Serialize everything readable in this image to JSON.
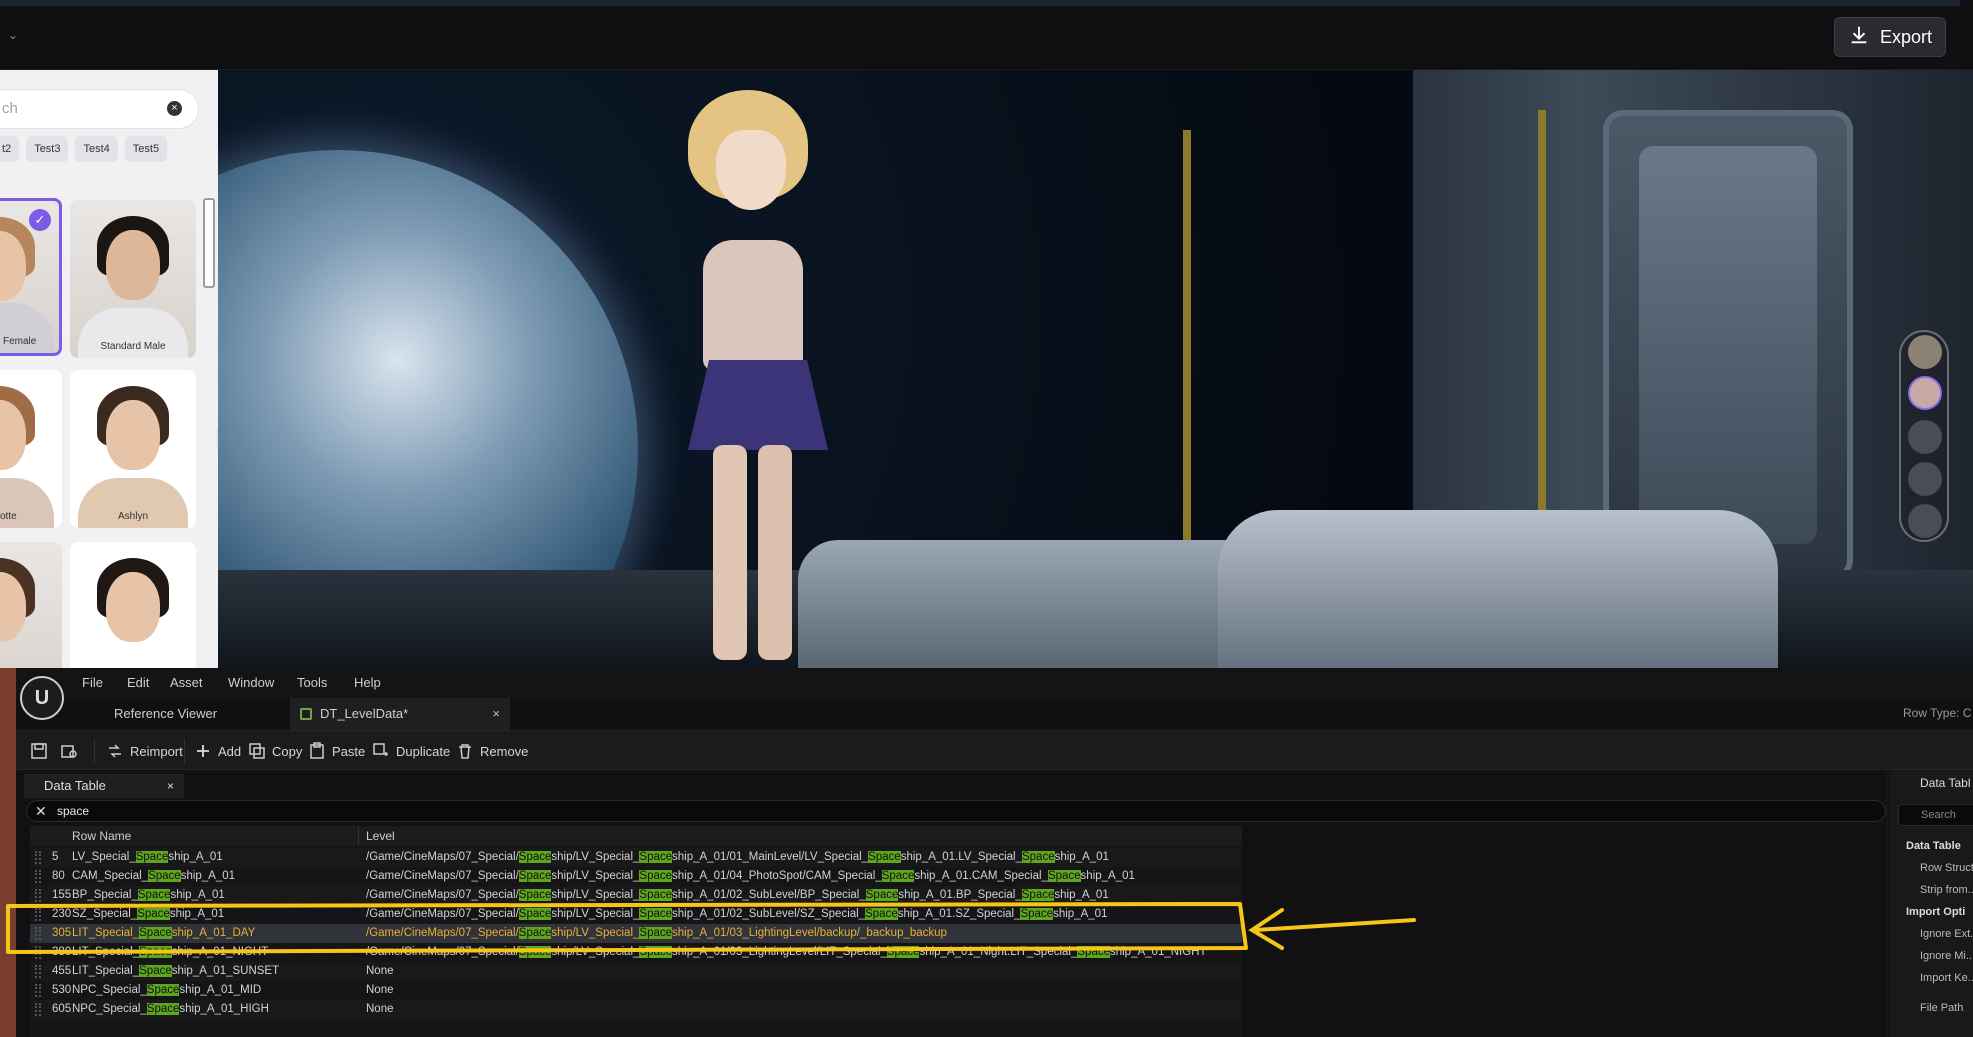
{
  "topbar": {
    "export_label": "Export"
  },
  "left_panel": {
    "search_placeholder": "ch",
    "chips": [
      "t2",
      "Test3",
      "Test4",
      "Test5"
    ],
    "avatars": [
      {
        "label": "Female",
        "selected": true
      },
      {
        "label": "Standard Male",
        "selected": false
      },
      {
        "label": "otte",
        "selected": false
      },
      {
        "label": "Ashlyn",
        "selected": false
      },
      {
        "label": "",
        "selected": false
      },
      {
        "label": "",
        "selected": false
      }
    ]
  },
  "editor": {
    "menu": [
      "File",
      "Edit",
      "Asset",
      "Window",
      "Tools",
      "Help"
    ],
    "tabs": {
      "reference_viewer": "Reference Viewer",
      "active": "DT_LevelData*"
    },
    "row_type_label": "Row Type: C",
    "toolbar": {
      "reimport": "Reimport",
      "add": "Add",
      "copy": "Copy",
      "paste": "Paste",
      "duplicate": "Duplicate",
      "remove": "Remove"
    },
    "data_table_tab": "Data Table",
    "filter_value": "space",
    "columns": [
      "Row Name",
      "Level"
    ],
    "rows": [
      {
        "num": "5",
        "name_pre": "LV_Special_",
        "name_hl": "Space",
        "name_post": "ship_A_01",
        "level": [
          "/Game/CineMaps/07_Special/",
          "Space",
          "ship/LV_Special_",
          "Space",
          "ship_A_01/01_MainLevel/LV_Special_",
          "Space",
          "ship_A_01.LV_Special_",
          "Space",
          "ship_A_01"
        ]
      },
      {
        "num": "80",
        "name_pre": "CAM_Special_",
        "name_hl": "Space",
        "name_post": "ship_A_01",
        "level": [
          "/Game/CineMaps/07_Special/",
          "Space",
          "ship/LV_Special_",
          "Space",
          "ship_A_01/04_PhotoSpot/CAM_Special_",
          "Space",
          "ship_A_01.CAM_Special_",
          "Space",
          "ship_A_01"
        ]
      },
      {
        "num": "155",
        "name_pre": "BP_Special_",
        "name_hl": "Space",
        "name_post": "ship_A_01",
        "level": [
          "/Game/CineMaps/07_Special/",
          "Space",
          "ship/LV_Special_",
          "Space",
          "ship_A_01/02_SubLevel/BP_Special_",
          "Space",
          "ship_A_01.BP_Special_",
          "Space",
          "ship_A_01"
        ]
      },
      {
        "num": "230",
        "name_pre": "SZ_Special_",
        "name_hl": "Space",
        "name_post": "ship_A_01",
        "level": [
          "/Game/CineMaps/07_Special/",
          "Space",
          "ship/LV_Special_",
          "Space",
          "ship_A_01/02_SubLevel/SZ_Special_",
          "Space",
          "ship_A_01.SZ_Special_",
          "Space",
          "ship_A_01"
        ]
      },
      {
        "num": "305",
        "name_pre": "LIT_Special_",
        "name_hl": "Space",
        "name_post": "ship_A_01_DAY",
        "level": [
          "/Game/CineMaps/07_Special/",
          "Space",
          "ship/LV_Special_",
          "Space",
          "ship_A_01/03_LightingLevel/backup/_backup_backup",
          "",
          "",
          "",
          ""
        ],
        "selected": true
      },
      {
        "num": "380",
        "name_pre": "LIT_Special_",
        "name_hl": "Space",
        "name_post": "ship_A_01_NIGHT",
        "level": [
          "/Game/CineMaps/07_Special/",
          "Space",
          "ship/LV_Special_",
          "Space",
          "ship_A_01/03_LightingLevel/LIT_Special_",
          "Space",
          "ship_A_01_Night.LIT_Special_",
          "Space",
          "ship_A_01_NIGHT"
        ]
      },
      {
        "num": "455",
        "name_pre": "LIT_Special_",
        "name_hl": "Space",
        "name_post": "ship_A_01_SUNSET",
        "level": [
          "None",
          "",
          "",
          "",
          "",
          "",
          "",
          "",
          ""
        ]
      },
      {
        "num": "530",
        "name_pre": "NPC_Special_",
        "name_hl": "Space",
        "name_post": "ship_A_01_MID",
        "level": [
          "None",
          "",
          "",
          "",
          "",
          "",
          "",
          "",
          ""
        ]
      },
      {
        "num": "605",
        "name_pre": "NPC_Special_",
        "name_hl": "Space",
        "name_post": "ship_A_01_HIGH",
        "level": [
          "None",
          "",
          "",
          "",
          "",
          "",
          "",
          "",
          ""
        ]
      }
    ],
    "right_panel": {
      "title": "Data Tabl",
      "search_placeholder": "Search",
      "items": [
        "Data Table",
        "Row Struct",
        "Strip from...",
        "Import Opti",
        "Ignore Ext...",
        "Ignore Mi...",
        "Import Ke...",
        "File Path"
      ]
    }
  },
  "colors": {
    "highlight": "#5ea61e",
    "selected_text": "#e7b233",
    "annotation": "#f5c518",
    "accent": "#7c5ce6"
  }
}
